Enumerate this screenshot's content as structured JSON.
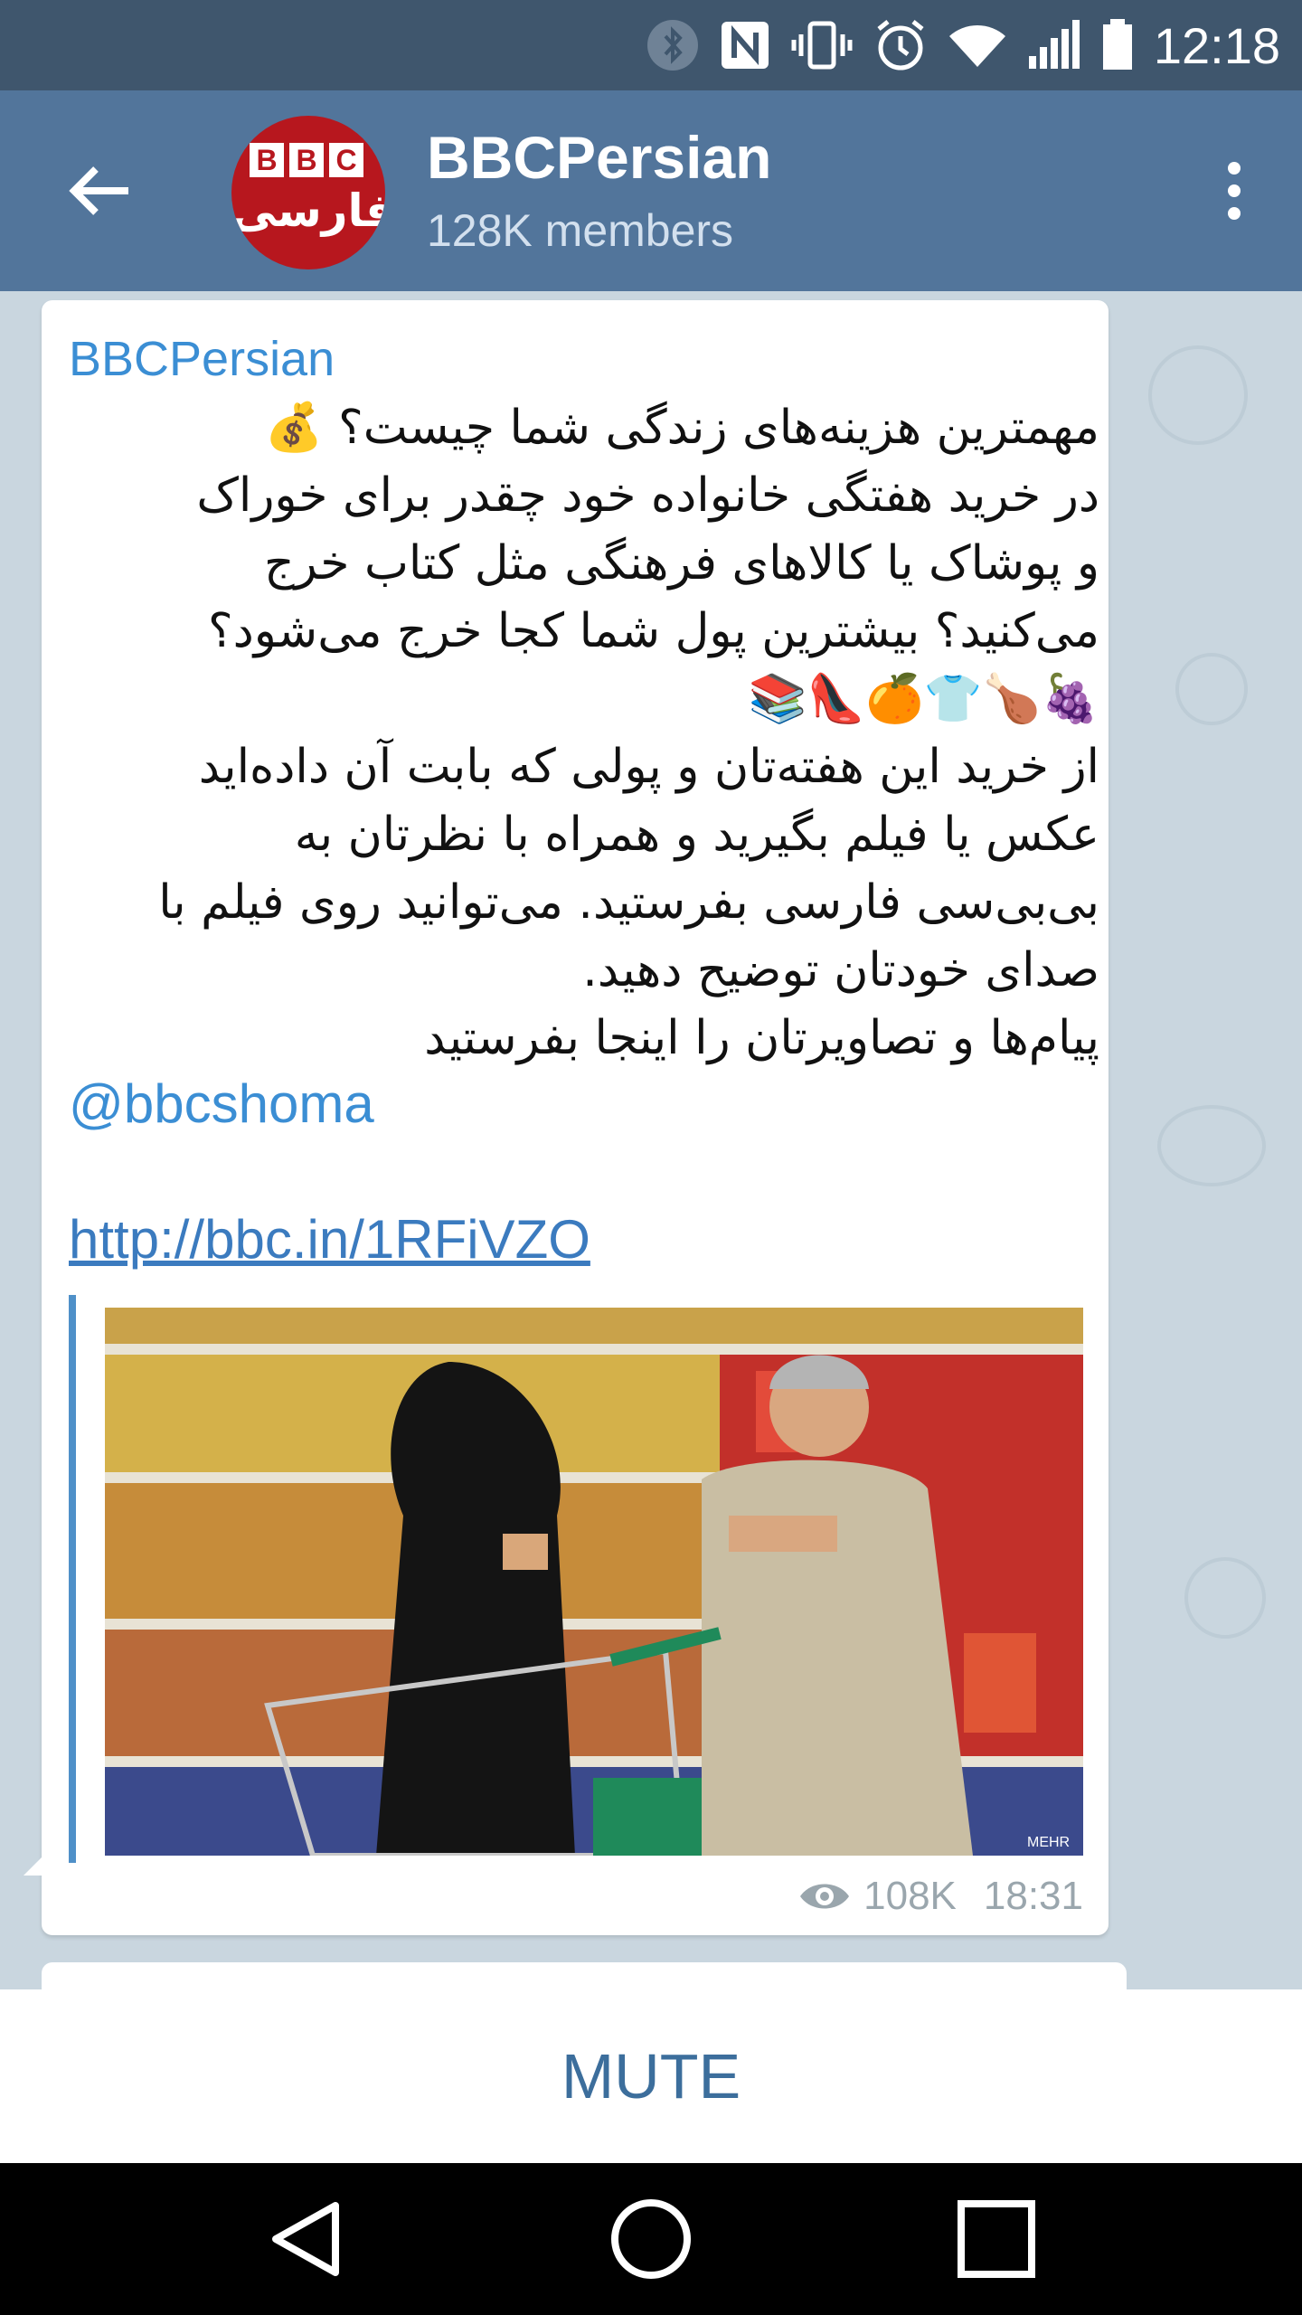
{
  "status_bar": {
    "time": "12:18",
    "icons": [
      "bluetooth-icon",
      "nfc-icon",
      "vibrate-icon",
      "alarm-icon",
      "wifi-icon",
      "signal-icon",
      "battery-icon"
    ]
  },
  "header": {
    "title": "BBCPersian",
    "subtitle": "128K members",
    "avatar_letters": [
      "B",
      "B",
      "C"
    ],
    "avatar_text": "فارسی"
  },
  "message": {
    "sender": "BBCPersian",
    "lines": [
      "مهمترین هزینه‌های زندگی شما چیست؟ 💰",
      "در خرید هفتگی خانواده خود چقدر برای خوراک",
      "و پوشاک یا کالاهای فرهنگی مثل کتاب خرج",
      "می‌کنید؟ بیشترین پول شما کجا خرج می‌شود؟",
      "🍇🍗👕🍊👠📚",
      "از خرید این هفته‌تان و پولی که بابت آن داده‌اید",
      "عکس یا فیلم بگیرید و  همراه با نظرتان به",
      "بی‌بی‌سی فارسی بفرستید. می‌توانید روی فیلم با",
      "صدای خودتان توضیح دهید.",
      "پیام‌ها و تصاویرتان را اینجا بفرستید"
    ],
    "mention": "@bbcshoma",
    "link": "http://bbc.in/1RFiVZO",
    "preview_watermark": "MEHR",
    "views": "108K",
    "time": "18:31"
  },
  "mute_bar": {
    "label": "MUTE"
  },
  "colors": {
    "status_bar": "#3f566d",
    "header": "#52759b",
    "chat_background": "#c9d6df",
    "link": "#3b8ed4",
    "mute": "#3c6e9c"
  }
}
